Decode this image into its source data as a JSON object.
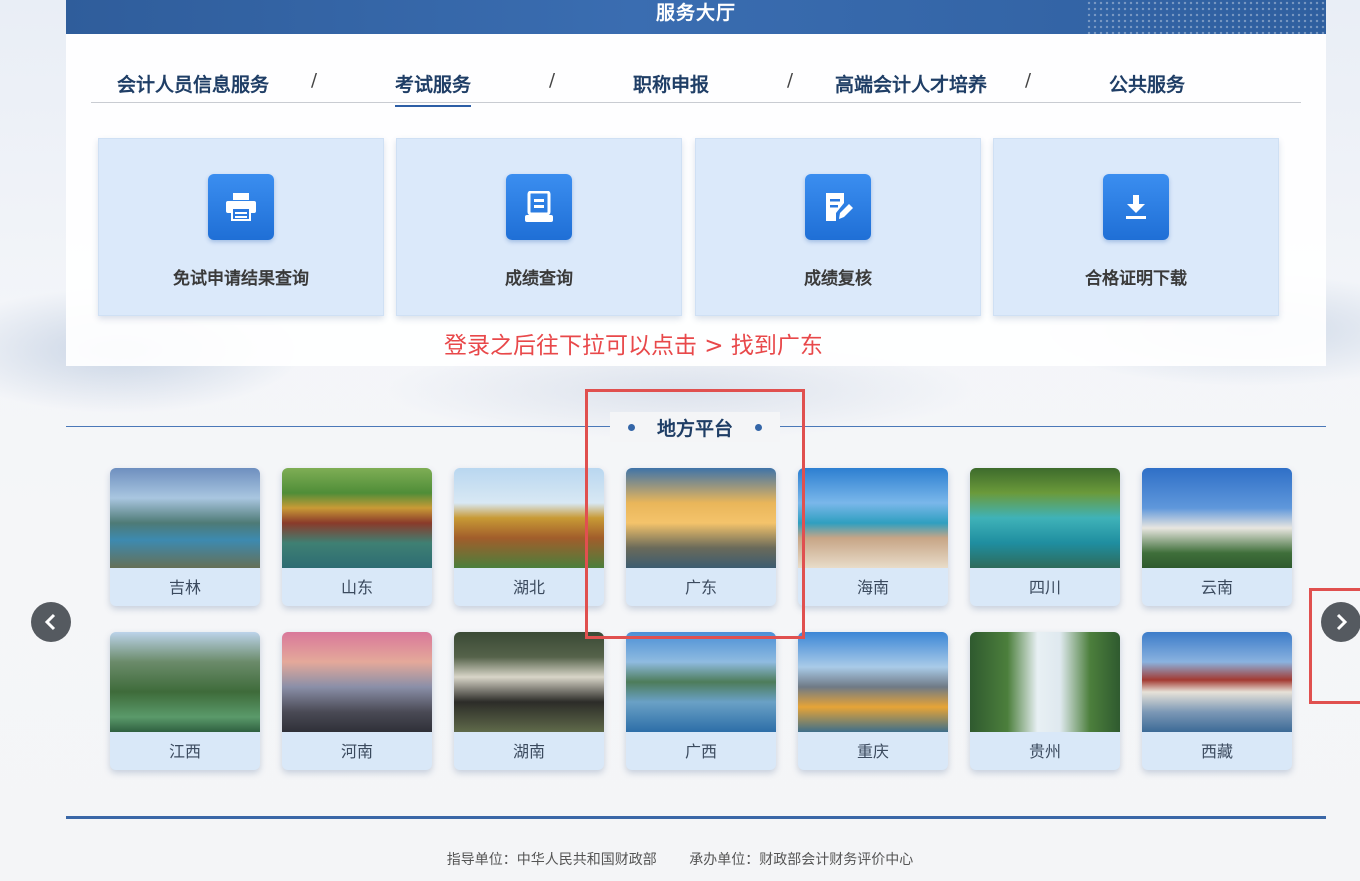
{
  "header": {
    "title": "服务大厅"
  },
  "tabs": [
    {
      "label": "会计人员信息服务"
    },
    {
      "label": "考试服务"
    },
    {
      "label": "职称申报"
    },
    {
      "label": "高端会计人才培养"
    },
    {
      "label": "公共服务"
    }
  ],
  "tab_separator": "/",
  "active_tab": "考试服务",
  "service_cards": [
    {
      "label": "免试申请结果查询",
      "icon": "printer-icon"
    },
    {
      "label": "成绩查询",
      "icon": "document-icon"
    },
    {
      "label": "成绩复核",
      "icon": "edit-document-icon"
    },
    {
      "label": "合格证明下载",
      "icon": "download-icon"
    }
  ],
  "annotation": "登录之后往下拉可以点击 > 找到广东",
  "local_section": {
    "title": "地方平台"
  },
  "provinces_row1": [
    "吉林",
    "山东",
    "湖北",
    "广东",
    "海南",
    "四川",
    "云南"
  ],
  "provinces_row2": [
    "江西",
    "河南",
    "湖南",
    "广西",
    "重庆",
    "贵州",
    "西藏"
  ],
  "footer": {
    "guide": "指导单位：中华人民共和国财政部",
    "host": "承办单位：财政部会计财务评价中心"
  },
  "colors": {
    "accent": "#2d5ea6",
    "annotation": "#e8484a",
    "card_bg": "#dbe9fa"
  }
}
